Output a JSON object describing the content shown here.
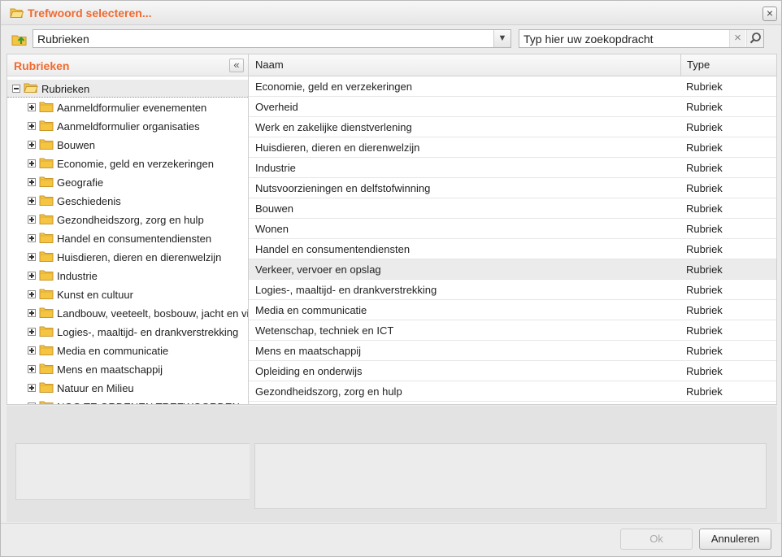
{
  "dialog": {
    "title": "Trefwoord selecteren..."
  },
  "toolbar": {
    "combo_value": "Rubrieken",
    "search_placeholder": "Typ hier uw zoekopdracht"
  },
  "tree": {
    "title": "Rubrieken",
    "root_label": "Rubrieken",
    "items": [
      {
        "label": "Aanmeldformulier evenementen"
      },
      {
        "label": "Aanmeldformulier organisaties"
      },
      {
        "label": "Bouwen"
      },
      {
        "label": "Economie, geld en verzekeringen"
      },
      {
        "label": "Geografie"
      },
      {
        "label": "Geschiedenis"
      },
      {
        "label": "Gezondheidszorg, zorg en hulp"
      },
      {
        "label": "Handel en consumentendiensten"
      },
      {
        "label": "Huisdieren, dieren en dierenwelzijn"
      },
      {
        "label": "Industrie"
      },
      {
        "label": "Kunst en cultuur"
      },
      {
        "label": "Landbouw, veeteelt, bosbouw, jacht en visserij"
      },
      {
        "label": "Logies-, maaltijd- en drankverstrekking"
      },
      {
        "label": "Media en communicatie"
      },
      {
        "label": "Mens en maatschappij"
      },
      {
        "label": "Natuur en Milieu"
      },
      {
        "label": "NOG TE ORDENEN TREFWOORDEN"
      }
    ]
  },
  "grid": {
    "columns": {
      "naam": "Naam",
      "type": "Type"
    },
    "rows": [
      {
        "naam": "Economie, geld en verzekeringen",
        "type": "Rubriek"
      },
      {
        "naam": "Overheid",
        "type": "Rubriek"
      },
      {
        "naam": "Werk en zakelijke dienstverlening",
        "type": "Rubriek"
      },
      {
        "naam": "Huisdieren, dieren en dierenwelzijn",
        "type": "Rubriek"
      },
      {
        "naam": "Industrie",
        "type": "Rubriek"
      },
      {
        "naam": "Nutsvoorzieningen en delfstofwinning",
        "type": "Rubriek"
      },
      {
        "naam": "Bouwen",
        "type": "Rubriek"
      },
      {
        "naam": "Wonen",
        "type": "Rubriek"
      },
      {
        "naam": "Handel en consumentendiensten",
        "type": "Rubriek"
      },
      {
        "naam": "Verkeer, vervoer en opslag",
        "type": "Rubriek"
      },
      {
        "naam": "Logies-, maaltijd- en drankverstrekking",
        "type": "Rubriek"
      },
      {
        "naam": "Media en communicatie",
        "type": "Rubriek"
      },
      {
        "naam": "Wetenschap, techniek en ICT",
        "type": "Rubriek"
      },
      {
        "naam": "Mens en maatschappij",
        "type": "Rubriek"
      },
      {
        "naam": "Opleiding en onderwijs",
        "type": "Rubriek"
      },
      {
        "naam": "Gezondheidszorg, zorg en hulp",
        "type": "Rubriek"
      }
    ]
  },
  "footer": {
    "ok_label": "Ok",
    "cancel_label": "Annuleren"
  },
  "colors": {
    "accent": "#f06a2e",
    "folder": "#f5c542",
    "selected_row": "#ebebeb"
  }
}
